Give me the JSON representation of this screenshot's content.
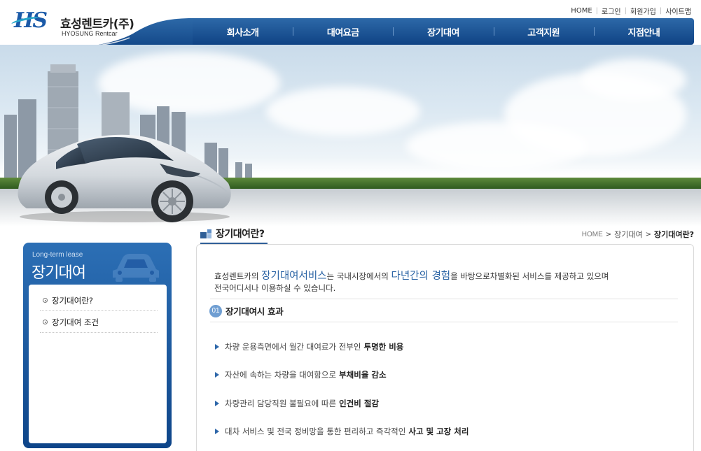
{
  "brand": {
    "logo_mark": "HS",
    "name_ko": "효성렌트카(주)",
    "name_en": "HYOSUNG Rentcar",
    "primary_color": "#0f4384",
    "accent_color": "#2a63a4"
  },
  "util_links": [
    "HOME",
    "로그인",
    "회원가입",
    "사이트맵"
  ],
  "gnb": [
    "회사소개",
    "대여요금",
    "장기대여",
    "고객지원",
    "지점안내"
  ],
  "visual": {
    "icon": "car-skyline-banner"
  },
  "sidebar": {
    "subtitle": "Long-term lease",
    "title": "장기대여",
    "icon": "car-icon",
    "items": [
      {
        "label": "장기대여란?"
      },
      {
        "label": "장기대여 조건"
      }
    ]
  },
  "page": {
    "title": "장기대여란?",
    "breadcrumb": [
      "HOME",
      "장기대여",
      "장기대여란?"
    ]
  },
  "intro": {
    "p1": "효성렌트카의",
    "em1": "장기대여서비스",
    "p2": "는 국내시장에서의",
    "em2": "다년간의 경험",
    "p3": "을 바탕으로차별화된 서비스를 제공하고 있으며",
    "line2": "전국어디서나 이용하실 수 있습니다."
  },
  "section": {
    "num": "01",
    "title": "장기대여시 효과"
  },
  "benefits": [
    {
      "text": "차량 운용측면에서 월간 대여료가 전부인",
      "strong": "투명한 비용"
    },
    {
      "text": "자산에 속하는 차량을 대여함으로",
      "strong": "부채비율 감소"
    },
    {
      "text": "차량관리 담당직원 불필요에 따른",
      "strong": "인건비 절감"
    },
    {
      "text": "대차 서비스 및 전국 정비망을 통한 편리하고 즉각적인",
      "strong": "사고 및 고장 처리"
    }
  ]
}
